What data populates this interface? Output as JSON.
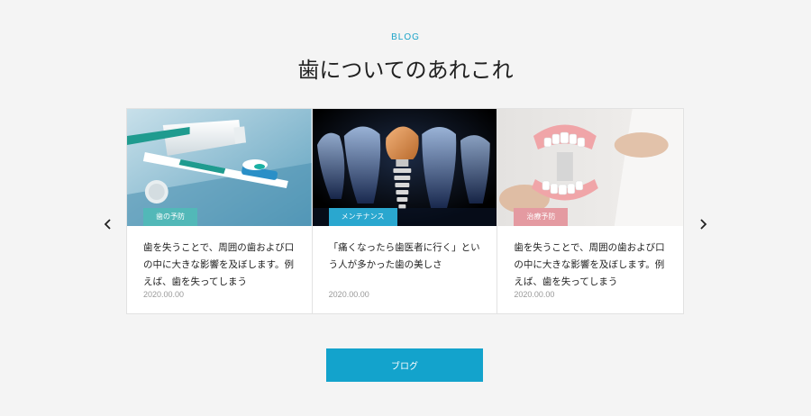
{
  "section": {
    "eyebrow": "BLOG",
    "title": "歯についてのあれこれ"
  },
  "carousel": {
    "prev_icon": "chevron-left-icon",
    "next_icon": "chevron-right-icon",
    "cards": [
      {
        "tag": "歯の予防",
        "tag_color": "#52b8b8",
        "image": "toothbrush-toothpaste-photo",
        "excerpt": "歯を失うことで、周囲の歯および口の中に大きな影響を及ぼします。例えば、歯を失ってしまう",
        "date": "2020.00.00"
      },
      {
        "tag": "メンテナンス",
        "tag_color": "#2aa7cf",
        "image": "dental-implant-xray-photo",
        "excerpt": "「痛くなったら歯医者に行く」という人が多かった歯の美しさ",
        "date": "2020.00.00"
      },
      {
        "tag": "治療予防",
        "tag_color": "#e49aa1",
        "image": "dental-model-photo",
        "excerpt": "歯を失うことで、周囲の歯および口の中に大きな影響を及ぼします。例えば、歯を失ってしまう",
        "date": "2020.00.00"
      }
    ]
  },
  "cta": {
    "label": "ブログ"
  }
}
